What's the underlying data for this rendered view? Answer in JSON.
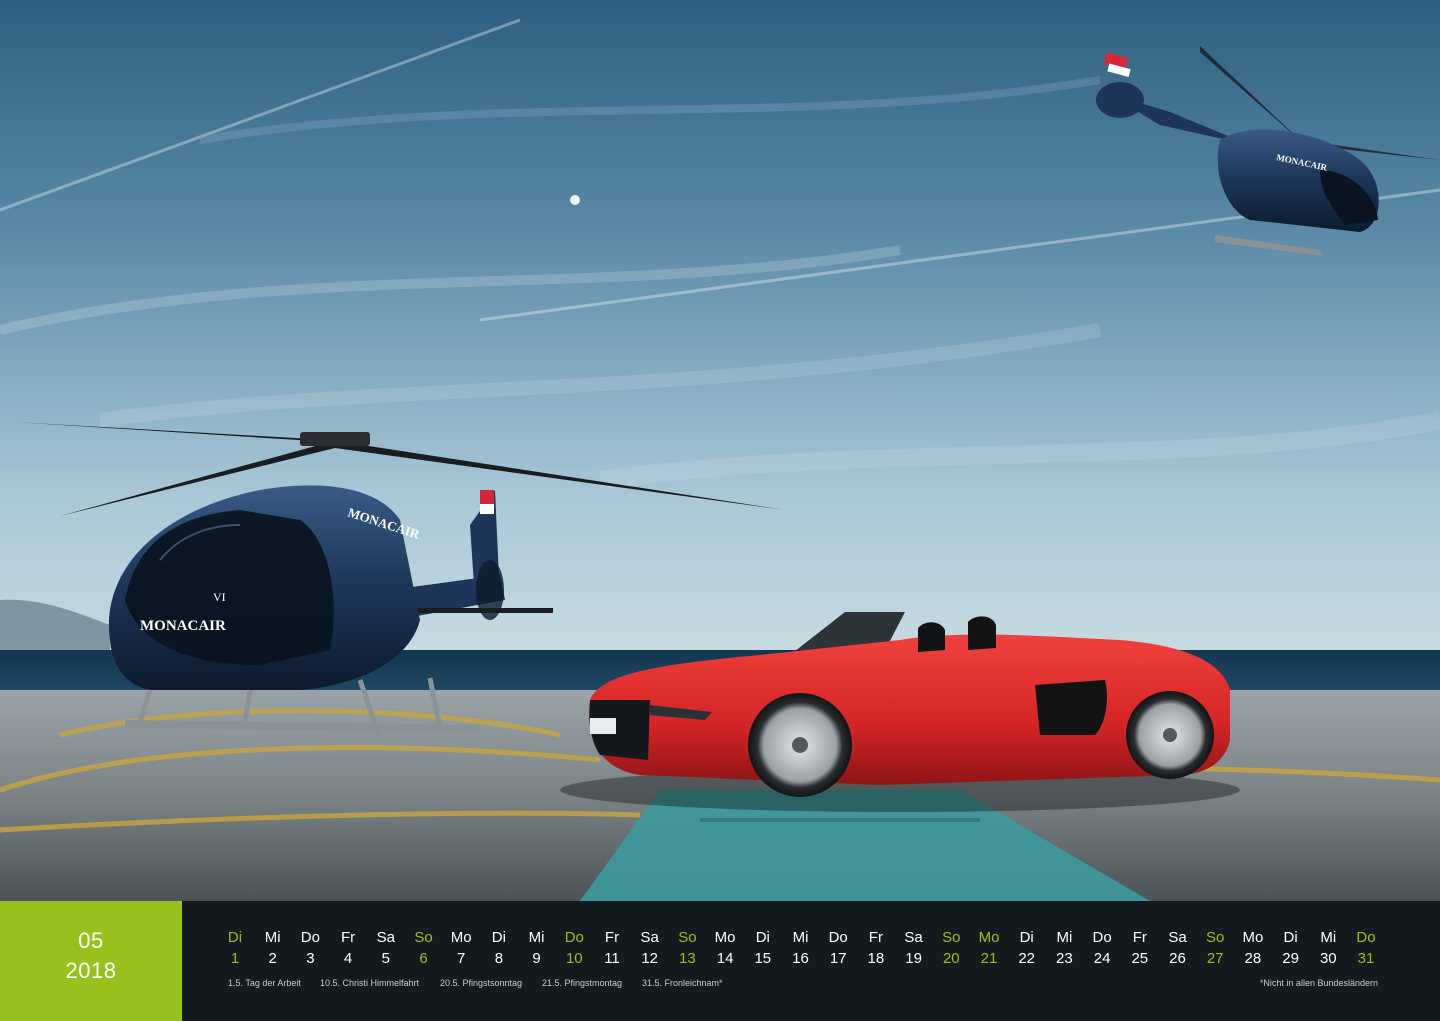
{
  "month": {
    "number": "05",
    "year": "2018"
  },
  "days": [
    {
      "wd": "Di",
      "day": "1",
      "kind": "holiday"
    },
    {
      "wd": "Mi",
      "day": "2",
      "kind": "normal"
    },
    {
      "wd": "Do",
      "day": "3",
      "kind": "normal"
    },
    {
      "wd": "Fr",
      "day": "4",
      "kind": "normal"
    },
    {
      "wd": "Sa",
      "day": "5",
      "kind": "normal"
    },
    {
      "wd": "So",
      "day": "6",
      "kind": "sunday"
    },
    {
      "wd": "Mo",
      "day": "7",
      "kind": "normal"
    },
    {
      "wd": "Di",
      "day": "8",
      "kind": "normal"
    },
    {
      "wd": "Mi",
      "day": "9",
      "kind": "normal"
    },
    {
      "wd": "Do",
      "day": "10",
      "kind": "holiday"
    },
    {
      "wd": "Fr",
      "day": "11",
      "kind": "normal"
    },
    {
      "wd": "Sa",
      "day": "12",
      "kind": "normal"
    },
    {
      "wd": "So",
      "day": "13",
      "kind": "sunday"
    },
    {
      "wd": "Mo",
      "day": "14",
      "kind": "normal"
    },
    {
      "wd": "Di",
      "day": "15",
      "kind": "normal"
    },
    {
      "wd": "Mi",
      "day": "16",
      "kind": "normal"
    },
    {
      "wd": "Do",
      "day": "17",
      "kind": "normal"
    },
    {
      "wd": "Fr",
      "day": "18",
      "kind": "normal"
    },
    {
      "wd": "Sa",
      "day": "19",
      "kind": "normal"
    },
    {
      "wd": "So",
      "day": "20",
      "kind": "sunday"
    },
    {
      "wd": "Mo",
      "day": "21",
      "kind": "holiday"
    },
    {
      "wd": "Di",
      "day": "22",
      "kind": "normal"
    },
    {
      "wd": "Mi",
      "day": "23",
      "kind": "normal"
    },
    {
      "wd": "Do",
      "day": "24",
      "kind": "normal"
    },
    {
      "wd": "Fr",
      "day": "25",
      "kind": "normal"
    },
    {
      "wd": "Sa",
      "day": "26",
      "kind": "normal"
    },
    {
      "wd": "So",
      "day": "27",
      "kind": "sunday"
    },
    {
      "wd": "Mo",
      "day": "28",
      "kind": "normal"
    },
    {
      "wd": "Di",
      "day": "29",
      "kind": "normal"
    },
    {
      "wd": "Mi",
      "day": "30",
      "kind": "normal"
    },
    {
      "wd": "Do",
      "day": "31",
      "kind": "holiday"
    }
  ],
  "holidays": [
    "1.5. Tag der Arbeit",
    "10.5. Christi Himmelfahrt",
    "20.5. Pfingstsonntag",
    "21.5. Pfingstmontag",
    "31.5. Fronleichnam*"
  ],
  "footnote": "*Nicht in allen Bundesländern",
  "photo": {
    "helicopter_livery_main": "MONACAIR",
    "helicopter_livery_side": "MONACAIR",
    "helicopter_code": "VI",
    "flying_helicopter_livery": "MONACAIR"
  },
  "colors": {
    "accent_green": "#97c21e",
    "car_red": "#d42426",
    "helicopter_blue": "#1c3558"
  }
}
